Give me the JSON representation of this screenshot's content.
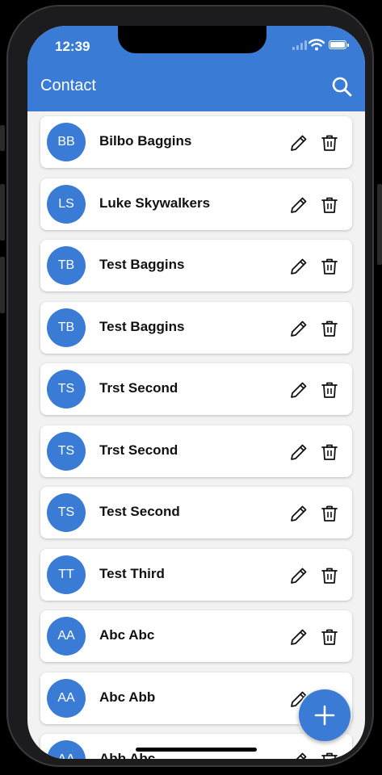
{
  "status_bar": {
    "time": "12:39"
  },
  "header": {
    "title": "Contact",
    "search_icon": "search-icon"
  },
  "contacts": [
    {
      "initials": "BB",
      "name": "Bilbo Baggins"
    },
    {
      "initials": "LS",
      "name": "Luke Skywalkers"
    },
    {
      "initials": "TB",
      "name": "Test Baggins"
    },
    {
      "initials": "TB",
      "name": "Test Baggins"
    },
    {
      "initials": "TS",
      "name": "Trst Second"
    },
    {
      "initials": "TS",
      "name": "Trst Second"
    },
    {
      "initials": "TS",
      "name": "Test Second"
    },
    {
      "initials": "TT",
      "name": "Test Third"
    },
    {
      "initials": "AA",
      "name": "Abc Abc"
    },
    {
      "initials": "AA",
      "name": "Abc Abb"
    },
    {
      "initials": "AA",
      "name": "Abb Abc"
    }
  ],
  "row_icons": {
    "edit": "pencil-icon",
    "delete": "trash-icon"
  },
  "fab_icon": "plus-icon",
  "colors": {
    "primary": "#3a7bd5",
    "background": "#f2f2f2",
    "card": "#ffffff"
  }
}
